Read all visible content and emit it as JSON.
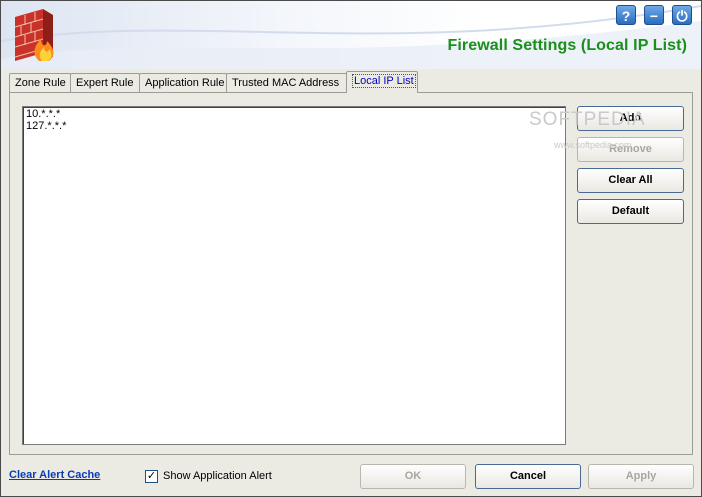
{
  "window": {
    "title": "Firewall Settings (Local IP List)",
    "buttons": {
      "help": "?",
      "minimize": "−",
      "power": "⏻"
    }
  },
  "tabs": [
    {
      "label": "Zone Rule",
      "active": false
    },
    {
      "label": "Expert Rule",
      "active": false
    },
    {
      "label": "Application Rule",
      "active": false
    },
    {
      "label": "Trusted MAC Address",
      "active": false
    },
    {
      "label": "Local IP List",
      "active": true
    }
  ],
  "ip_list": [
    "10.*.*.*",
    "127.*.*.*"
  ],
  "actions": {
    "add": "Add",
    "remove": "Remove",
    "clear_all": "Clear All",
    "default": "Default"
  },
  "watermark": {
    "text": "SOFTPEDIA",
    "sub": "www.softpedia.com"
  },
  "footer": {
    "clear_cache": "Clear Alert Cache",
    "show_alert_label": "Show Application Alert",
    "show_alert_checked": true,
    "ok": "OK",
    "cancel": "Cancel",
    "apply": "Apply"
  },
  "colors": {
    "title": "#1a8f1a",
    "link": "#0a3cb4",
    "active_tab": "#0000c8"
  }
}
